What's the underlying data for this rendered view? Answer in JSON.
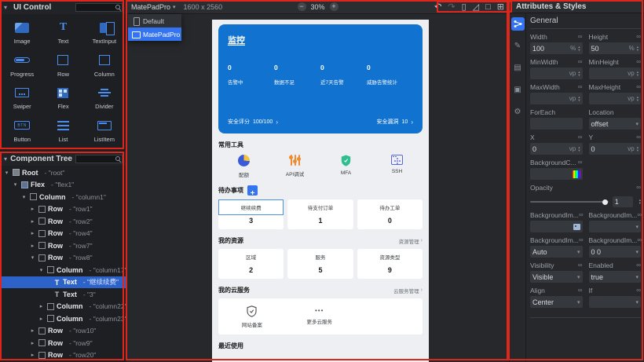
{
  "ui_control": {
    "title": "UI Control",
    "items": [
      {
        "label": "Image"
      },
      {
        "label": "Text"
      },
      {
        "label": "TextInput"
      },
      {
        "label": "Progress"
      },
      {
        "label": "Row"
      },
      {
        "label": "Column"
      },
      {
        "label": "Swiper"
      },
      {
        "label": "Flex"
      },
      {
        "label": "Divider"
      },
      {
        "label": "Button"
      },
      {
        "label": "List"
      },
      {
        "label": "ListItem"
      }
    ]
  },
  "component_tree": {
    "title": "Component Tree",
    "nodes": [
      {
        "type": "Root",
        "value": "- \"root\""
      },
      {
        "type": "Flex",
        "value": "- \"flex1\""
      },
      {
        "type": "Column",
        "value": "- \"column1\""
      },
      {
        "type": "Row",
        "value": "- \"row1\""
      },
      {
        "type": "Row",
        "value": "- \"row2\""
      },
      {
        "type": "Row",
        "value": "- \"row4\""
      },
      {
        "type": "Row",
        "value": "- \"row7\""
      },
      {
        "type": "Row",
        "value": "- \"row8\""
      },
      {
        "type": "Column",
        "value": "- \"column17\""
      },
      {
        "type": "Text",
        "value": "- \"继续续费\""
      },
      {
        "type": "Text",
        "value": "- \"3\""
      },
      {
        "type": "Column",
        "value": "- \"column22\""
      },
      {
        "type": "Column",
        "value": "- \"column23\""
      },
      {
        "type": "Row",
        "value": "- \"row10\""
      },
      {
        "type": "Row",
        "value": "- \"row9\""
      },
      {
        "type": "Row",
        "value": "- \"row20\""
      }
    ]
  },
  "canvas": {
    "device": "MatePadPro",
    "resolution": "1600 x 2560",
    "zoom_level": "30%",
    "zoom_out": "−",
    "zoom_in": "+",
    "menu_items": [
      {
        "label": "Default"
      },
      {
        "label": "MatePadPro"
      }
    ]
  },
  "preview": {
    "monitor": {
      "title": "监控",
      "stats": [
        {
          "value": "0",
          "label": "告警中"
        },
        {
          "value": "0",
          "label": "数据不足"
        },
        {
          "value": "0",
          "label": "近7天告警"
        },
        {
          "value": "0",
          "label": "威胁告警统计"
        }
      ],
      "score_label": "安全评分",
      "score_value": "100/100",
      "vuln_label": "安全漏洞",
      "vuln_value": "10"
    },
    "tools": {
      "title": "常用工具",
      "items": [
        {
          "label": "配额"
        },
        {
          "label": "API调试"
        },
        {
          "label": "MFA"
        },
        {
          "label": "SSH"
        }
      ]
    },
    "todo": {
      "title": "待办事项",
      "cards": [
        {
          "label": "继续续费",
          "value": "3"
        },
        {
          "label": "待支付订单",
          "value": "1"
        },
        {
          "label": "待办工单",
          "value": "0"
        }
      ]
    },
    "resources": {
      "title": "我的资源",
      "link": "资源管理",
      "cards": [
        {
          "label": "区域",
          "value": "2"
        },
        {
          "label": "服务",
          "value": "5"
        },
        {
          "label": "资源类型",
          "value": "9"
        }
      ]
    },
    "cloud": {
      "title": "我的云服务",
      "link": "云服务管理",
      "items": [
        {
          "label": "网站备案"
        },
        {
          "label": "更多云服务"
        }
      ]
    },
    "recent_title": "最近使用"
  },
  "attributes": {
    "title": "Attributes & Styles",
    "section": "General",
    "fields": {
      "width": {
        "label": "Width",
        "value": "100",
        "unit": "%"
      },
      "height": {
        "label": "Height",
        "value": "50",
        "unit": "%"
      },
      "minwidth": {
        "label": "MinWidth",
        "value": "",
        "unit": "vp"
      },
      "minheight": {
        "label": "MinHeight",
        "value": "",
        "unit": "vp"
      },
      "maxwidth": {
        "label": "MaxWidth",
        "value": "",
        "unit": "vp"
      },
      "maxheight": {
        "label": "MaxHeight",
        "value": "",
        "unit": "vp"
      },
      "foreach": {
        "label": "ForEach",
        "value": ""
      },
      "location": {
        "label": "Location",
        "value": "offset"
      },
      "x": {
        "label": "X",
        "value": "0",
        "unit": "vp"
      },
      "y": {
        "label": "Y",
        "value": "0",
        "unit": "vp"
      },
      "background_color": {
        "label": "BackgroundC...",
        "value": ""
      },
      "opacity": {
        "label": "Opacity",
        "value": "1"
      },
      "background_image": {
        "label": "BackgroundIm...",
        "value": ""
      },
      "background_image_repeat": {
        "label": "BackgroundIm...",
        "value": ""
      },
      "background_image_size": {
        "label": "BackgroundIm...",
        "value": "Auto"
      },
      "background_image_position": {
        "label": "BackgroundIm...",
        "value": "0 0"
      },
      "visibility": {
        "label": "Visibility",
        "value": "Visible"
      },
      "enabled": {
        "label": "Enabled",
        "value": "true"
      },
      "align": {
        "label": "Align",
        "value": "Center"
      },
      "if": {
        "label": "If",
        "value": ""
      }
    }
  }
}
